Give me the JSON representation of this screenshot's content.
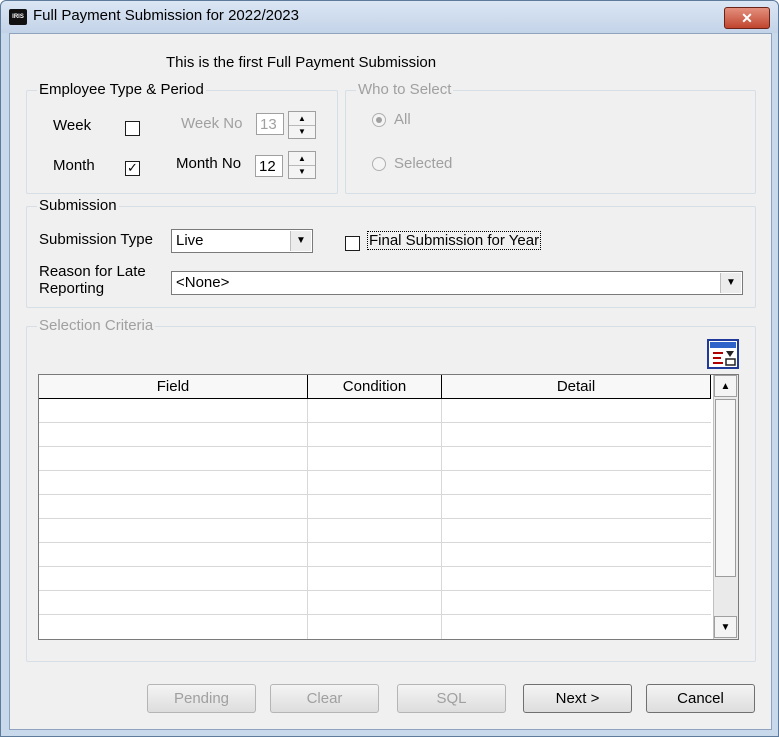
{
  "window": {
    "title": "Full Payment Submission for 2022/2023",
    "app_icon": "IRIS"
  },
  "info_text": "This is the first Full Payment Submission",
  "employee_type": {
    "legend": "Employee Type & Period",
    "week_label": "Week",
    "week_checked": false,
    "week_no_label": "Week No",
    "week_no_value": "13",
    "month_label": "Month",
    "month_checked": true,
    "month_no_label": "Month No",
    "month_no_value": "12"
  },
  "who_to_select": {
    "legend": "Who to Select",
    "options": [
      "All",
      "Selected"
    ],
    "selected": "All"
  },
  "submission": {
    "legend": "Submission",
    "type_label": "Submission Type",
    "type_value": "Live",
    "final_label": "Final Submission for Year",
    "final_checked": false,
    "reason_label_line1": "Reason for Late",
    "reason_label_line2": "Reporting",
    "reason_value": "<None>"
  },
  "selection_criteria": {
    "legend": "Selection Criteria",
    "columns": [
      "Field",
      "Condition",
      "Detail"
    ],
    "rows": 10
  },
  "buttons": {
    "pending": "Pending",
    "clear": "Clear",
    "sql": "SQL",
    "next": "Next >",
    "cancel": "Cancel"
  }
}
